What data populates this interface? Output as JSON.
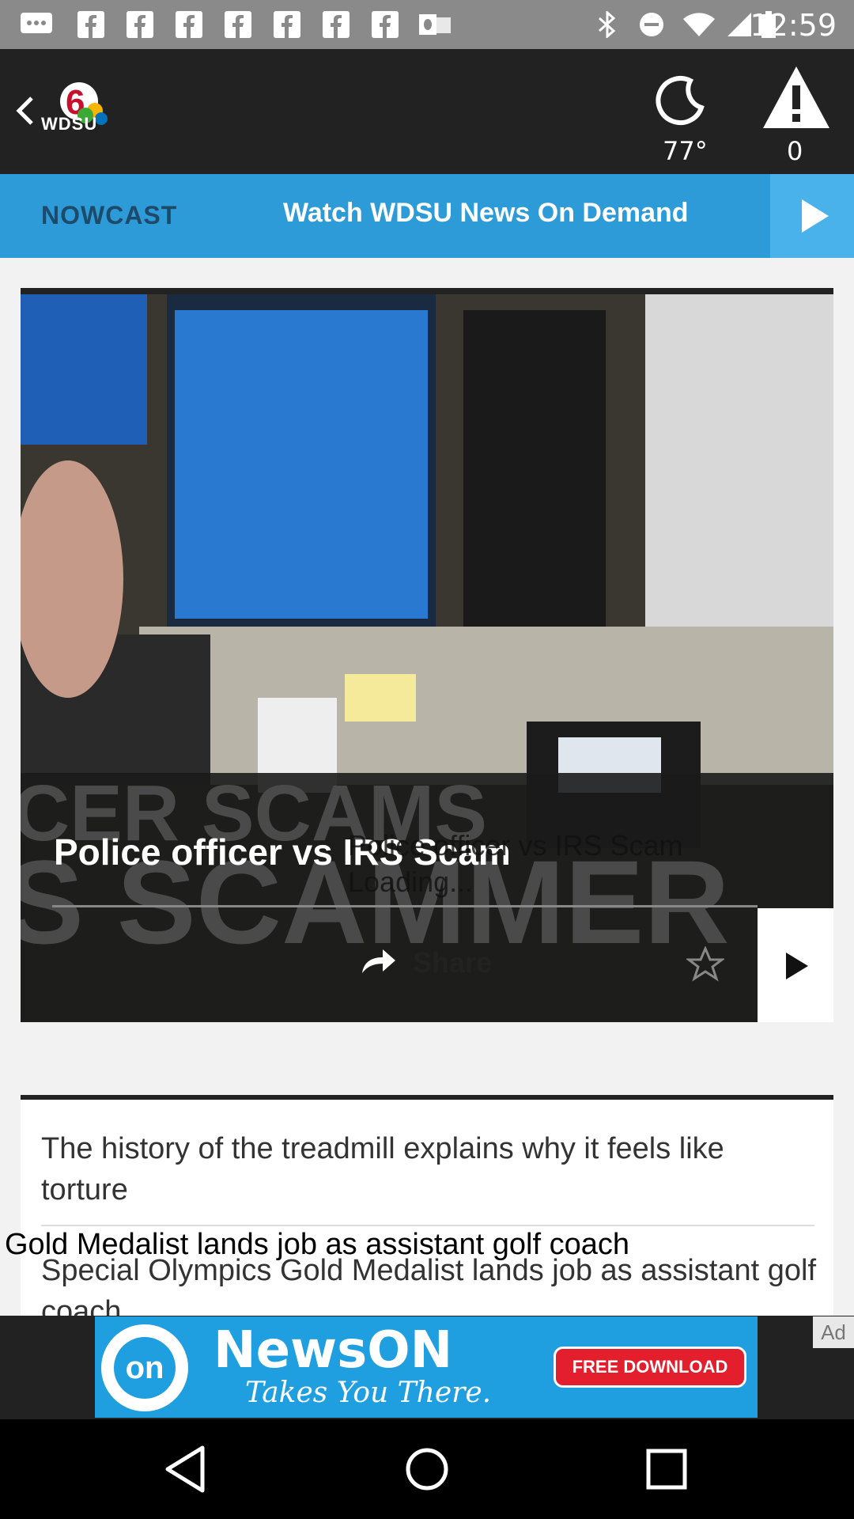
{
  "status_bar": {
    "time": "12:59",
    "icons": [
      "message-icon",
      "facebook-icon",
      "facebook-icon",
      "facebook-icon",
      "facebook-icon",
      "facebook-icon",
      "facebook-icon",
      "outlook-icon",
      "bluetooth-icon",
      "do-not-disturb-icon",
      "wifi-icon",
      "signal-icon",
      "battery-icon"
    ]
  },
  "header": {
    "logo_text": "WDSU",
    "weather_temp": "77°",
    "alert_count": "0"
  },
  "nav": {
    "nowcast_label": "NOWCAST",
    "ondemand_label": "Watch WDSU News On Demand"
  },
  "video": {
    "title": "Police officer vs IRS Scam",
    "title_ghost": "Police officer vs IRS Scam",
    "loading_text": "Loading...",
    "share_label": "Share"
  },
  "list": {
    "items": [
      {
        "title": "The history of the treadmill explains why it feels like torture"
      },
      {
        "title": "Special Olympics Gold Medalist lands job as assistant golf coach"
      }
    ],
    "ghost_text": "Gold Medalist lands job as assistant golf coach"
  },
  "ad": {
    "brand": "NewsON",
    "tagline": "Takes You There.",
    "cta": "FREE DOWNLOAD",
    "logo_text": "on",
    "badge": "Ad"
  },
  "colors": {
    "accent_blue": "#2c9bd8",
    "header_bg": "#222222",
    "status_bg": "#8a8a8a"
  }
}
